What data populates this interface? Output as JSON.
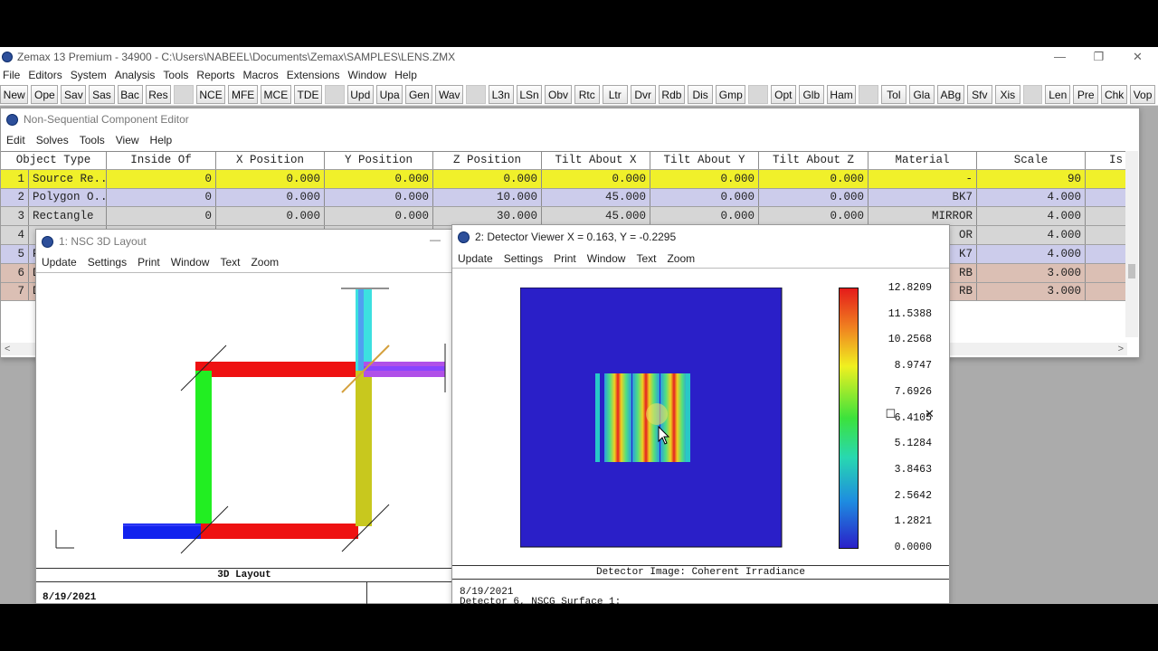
{
  "app": {
    "title": "Zemax 13 Premium - 34900 - C:\\Users\\NABEEL\\Documents\\Zemax\\SAMPLES\\LENS.ZMX",
    "menu": [
      "File",
      "Editors",
      "System",
      "Analysis",
      "Tools",
      "Reports",
      "Macros",
      "Extensions",
      "Window",
      "Help"
    ],
    "toolbar": [
      [
        "New",
        "Ope",
        "Sav",
        "Sas",
        "Bac",
        "Res"
      ],
      [
        "NCE",
        "MFE",
        "MCE",
        "TDE"
      ],
      [
        "Upd",
        "Upa",
        "Gen",
        "Wav"
      ],
      [
        "L3n",
        "LSn",
        "Obv",
        "Rtc",
        "Ltr",
        "Dvr",
        "Rdb",
        "Dis",
        "Gmp"
      ],
      [
        "Opt",
        "Glb",
        "Ham"
      ],
      [
        "Tol",
        "Gla",
        "ABg",
        "Sfv",
        "Xis"
      ],
      [
        "Len",
        "Pre",
        "Chk",
        "Vop"
      ]
    ],
    "win_min": "—",
    "win_restore": "❐",
    "win_close": "✕"
  },
  "editor": {
    "title": "Non-Sequential Component Editor",
    "menu": [
      "Edit",
      "Solves",
      "Tools",
      "View",
      "Help"
    ],
    "columns": [
      "Object Type",
      "Inside Of",
      "X Position",
      "Y Position",
      "Z Position",
      "Tilt About X",
      "Tilt About Y",
      "Tilt About Z",
      "Material",
      "Scale",
      "Is"
    ],
    "rows": [
      {
        "n": "1",
        "type": "Source Re..",
        "inside": "0",
        "x": "0.000",
        "y": "0.000",
        "z": "0.000",
        "tx": "0.000",
        "ty": "0.000",
        "tz": "0.000",
        "mat": "-",
        "scale": "90",
        "color": "yellow"
      },
      {
        "n": "2",
        "type": "Polygon O..",
        "inside": "0",
        "x": "0.000",
        "y": "0.000",
        "z": "10.000",
        "tx": "45.000",
        "ty": "0.000",
        "tz": "0.000",
        "mat": "BK7",
        "scale": "4.000",
        "color": "blue"
      },
      {
        "n": "3",
        "type": "  Rectangle",
        "inside": "0",
        "x": "0.000",
        "y": "0.000",
        "z": "30.000",
        "tx": "45.000",
        "ty": "0.000",
        "tz": "0.000",
        "mat": "MIRROR",
        "scale": "4.000",
        "color": "gray"
      },
      {
        "n": "4",
        "type": "",
        "inside": "",
        "x": "",
        "y": "",
        "z": "",
        "tx": "",
        "ty": "",
        "tz": "",
        "mat": "OR",
        "scale": "4.000",
        "color": "gray"
      },
      {
        "n": "5",
        "type": "P",
        "inside": "",
        "x": "",
        "y": "",
        "z": "",
        "tx": "",
        "ty": "",
        "tz": "",
        "mat": "K7",
        "scale": "4.000",
        "color": "blue"
      },
      {
        "n": "6",
        "type": "D",
        "inside": "",
        "x": "",
        "y": "",
        "z": "",
        "tx": "",
        "ty": "",
        "tz": "",
        "mat": "RB",
        "scale": "3.000",
        "color": "tan"
      },
      {
        "n": "7",
        "type": "D",
        "inside": "",
        "x": "",
        "y": "",
        "z": "",
        "tx": "",
        "ty": "",
        "tz": "",
        "mat": "RB",
        "scale": "3.000",
        "color": "tan"
      }
    ],
    "scroll_left": "<",
    "scroll_right": ">"
  },
  "layout3d": {
    "title": "1: NSC 3D Layout",
    "menu": [
      "Update",
      "Settings",
      "Print",
      "Window",
      "Text",
      "Zoom"
    ],
    "footer_title": "3D Layout",
    "date": "8/19/2021"
  },
  "detector": {
    "title": "2: Detector Viewer X = 0.163, Y = -0.2295",
    "menu": [
      "Update",
      "Settings",
      "Print",
      "Window",
      "Text",
      "Zoom"
    ],
    "footer_title": "Detector Image: Coherent Irradiance",
    "date": "8/19/2021",
    "footer_line2": "Detector 6, NSCG Surface 1:",
    "legend": [
      "12.8209",
      "11.5388",
      "10.2568",
      "8.9747",
      "7.6926",
      "6.4105",
      "5.1284",
      "3.8463",
      "2.5642",
      "1.2821",
      "0.0000"
    ],
    "colors": {
      "background": "#2a1fc8",
      "peak": "#e41a1a"
    }
  }
}
